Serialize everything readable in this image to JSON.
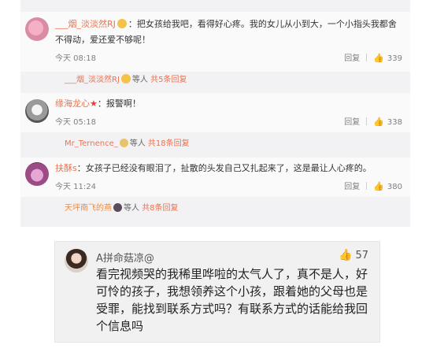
{
  "weibo": {
    "comments": [
      {
        "username": "___烟_淡淡然RJ",
        "text": "：把女孩给我吧，看得好心疼。我的女儿从小到大，一个小指头我都舍不得动，爱还爱不够呢！",
        "time": "今天 08:18",
        "reply_label": "回复",
        "likes": "339",
        "reply_preview": {
          "user": "___烟_淡淡然RJ",
          "label": "等人",
          "count_text": "共5条回复"
        }
      },
      {
        "username": "缘海龙心",
        "text": "：报警啊！",
        "time": "今天 05:18",
        "reply_label": "回复",
        "likes": "338",
        "reply_preview": {
          "user": "Mr_Ternence_",
          "label": "等人",
          "count_text": "共18条回复"
        }
      },
      {
        "username": "扶酥s",
        "text": "：女孩子已经没有眼泪了，扯散的头发自己又扎起来了，这是最让人心疼的。",
        "time": "今天 11:24",
        "reply_label": "回复",
        "likes": "380",
        "reply_preview": {
          "user": "天坪南飞的燕",
          "label": "等人",
          "count_text": "共8条回复"
        }
      }
    ]
  },
  "wechat_comment": {
    "username": "A拼命菇凉@",
    "likes": "57",
    "text": "看完视频哭的我稀里哗啦的太气人了，真不是人，好可怜的孩子，我想领养这个小孩，跟着她的父母也是受罪，能找到联系方式吗？有联系方式的话能给我回个信息吗"
  },
  "colors": {
    "username": "#eb7350",
    "reply_bg": "#f2f2f5",
    "card_bg": "#f1f1f1"
  },
  "icons": [
    "thumbs-up-icon",
    "avatar",
    "emoji-icon",
    "star-icon"
  ]
}
